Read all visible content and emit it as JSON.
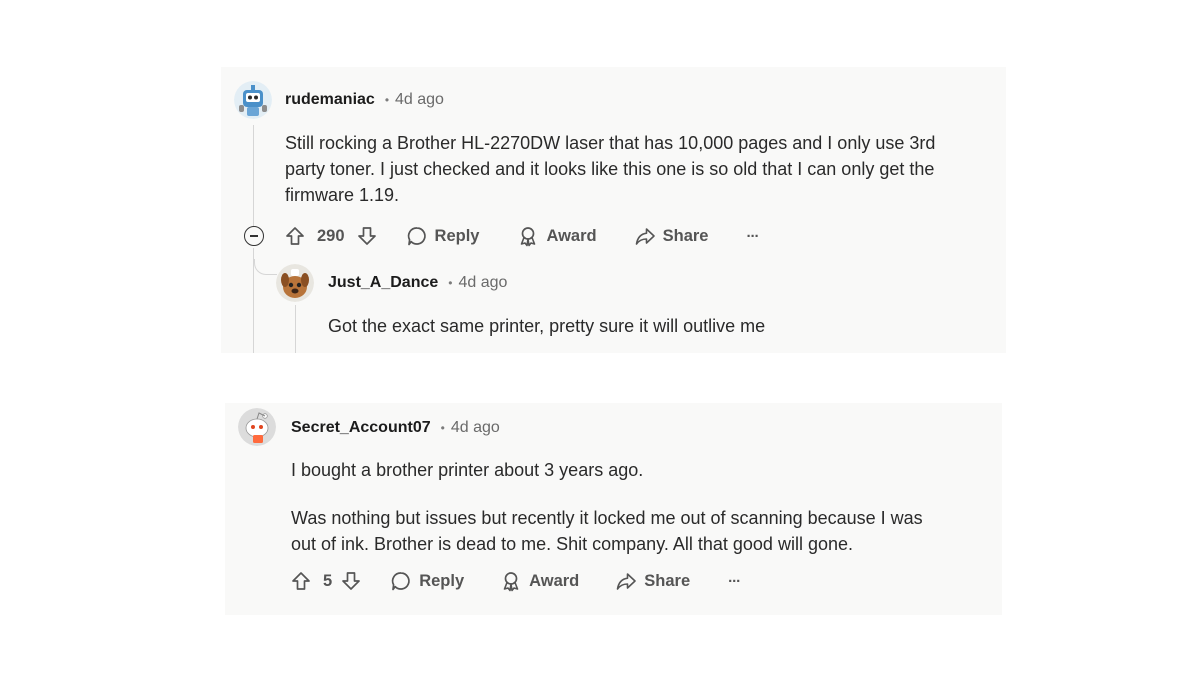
{
  "comments": [
    {
      "username": "rudemaniac",
      "dot": "•",
      "time": "4d ago",
      "lines": [
        "Still rocking a Brother HL-2270DW laser that has 10,000 pages and I only use 3rd",
        "party toner. I just checked and it looks like this one is so old that I can only get the",
        "firmware 1.19."
      ],
      "votes": "290",
      "reply_label": "Reply",
      "award_label": "Award",
      "share_label": "Share",
      "more_label": "···",
      "reply": {
        "username": "Just_A_Dance",
        "dot": "•",
        "time": "4d ago",
        "text": "Got the exact same printer, pretty sure it will outlive me"
      }
    },
    {
      "username": "Secret_Account07",
      "dot": "•",
      "time": "4d ago",
      "paragraph1": "I bought a brother printer about 3 years ago.",
      "lines": [
        "Was nothing but issues but recently it locked me out of scanning because I was",
        "out of ink. Brother is dead to me. Shit company. All that good will gone."
      ],
      "votes": "5",
      "reply_label": "Reply",
      "award_label": "Award",
      "share_label": "Share",
      "more_label": "···"
    }
  ],
  "icons": {
    "upvote": "arrow-up-icon",
    "downvote": "arrow-down-icon",
    "reply": "speech-bubble-icon",
    "award": "ribbon-award-icon",
    "share": "share-arrow-icon",
    "more": "more-dots-icon",
    "collapse": "minus-circle-icon"
  },
  "colors": {
    "card_background": "#f9f9f8",
    "text": "#2a2a2a",
    "muted": "#555555"
  }
}
